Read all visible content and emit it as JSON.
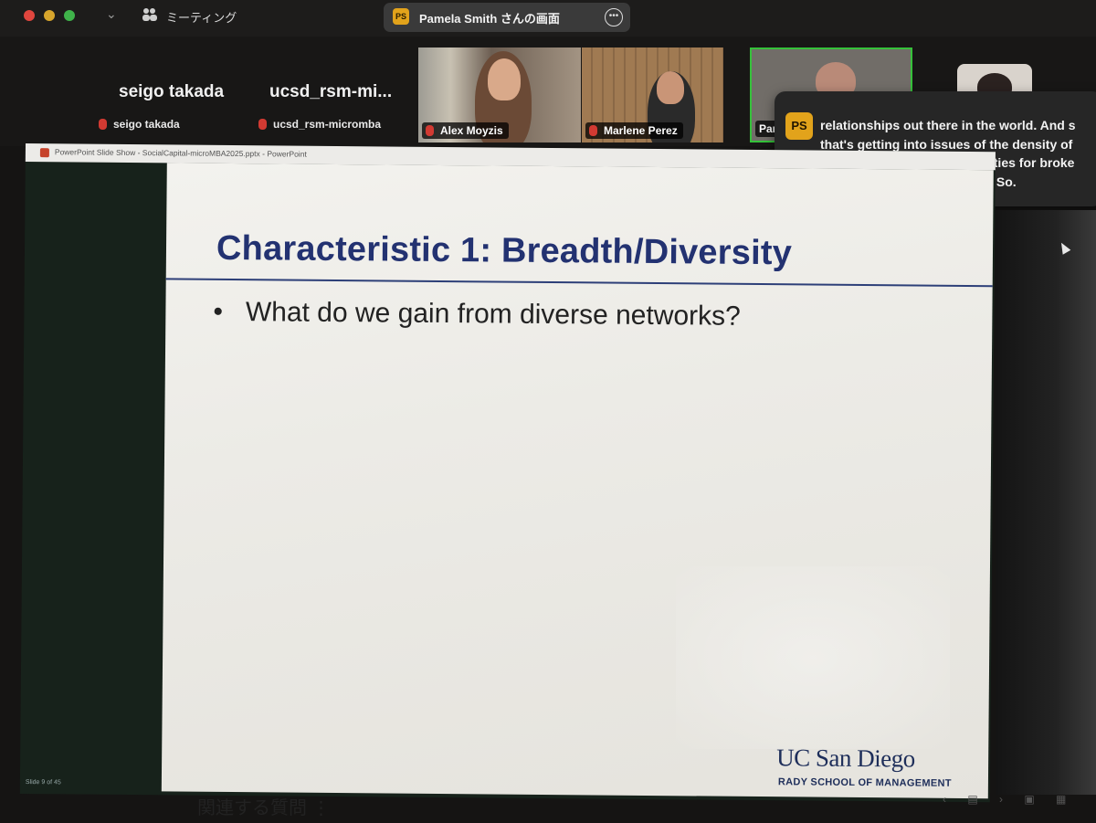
{
  "window": {
    "meeting_label": "ミーティング",
    "share_title": "Pamela Smith さんの画面",
    "share_avatar": "PS"
  },
  "gallery": {
    "name_tiles": [
      {
        "display_name": "seigo takada",
        "label": "seigo takada"
      },
      {
        "display_name": "ucsd_rsm-mi...",
        "label": "ucsd_rsm-micromba"
      }
    ],
    "video_tiles": [
      {
        "label": "Alex Moyzis"
      },
      {
        "label": "Marlene Perez"
      },
      {
        "label": "Pam"
      }
    ]
  },
  "caption": {
    "avatar": "PS",
    "text": "relationships out there in the world. And s\nthat's getting into issues of the density of\nnetwork, and your opportunities for broke\nIn your network. Um, alright. So."
  },
  "ppt": {
    "titlebar": "PowerPoint Slide Show  -  SocialCapital-microMBA2025.pptx  -  PowerPoint",
    "slide_title": "Characteristic 1: Breadth/Diversity",
    "bullet": "What do we gain from diverse networks?",
    "logo": "UC San Diego",
    "school": "RADY SCHOOL OF MANAGEMENT",
    "status": "Slide 9 of 45"
  },
  "bottom": {
    "related_questions": "関連する質問 ⋮"
  },
  "colors": {
    "title_blue": "#233271",
    "zoom_accent": "#e2a31b",
    "active_speaker": "#35c23a"
  }
}
